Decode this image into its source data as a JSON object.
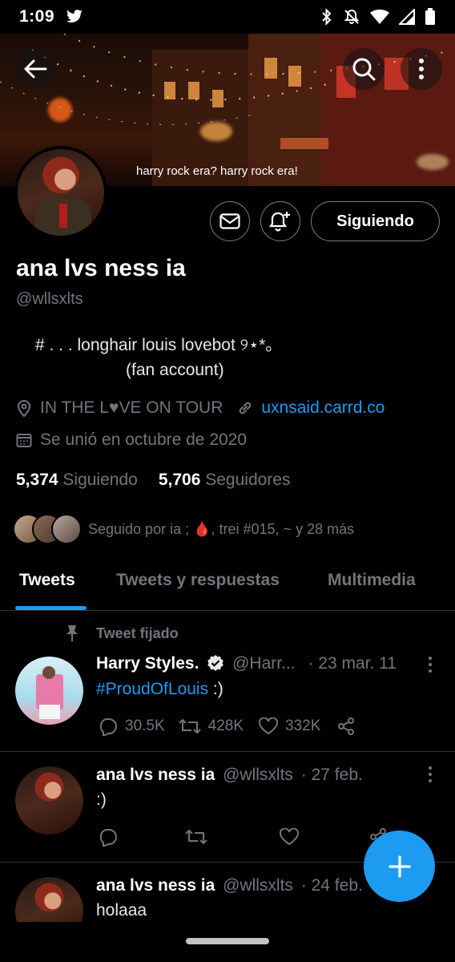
{
  "status_bar": {
    "time": "1:09"
  },
  "banner": {
    "caption": "harry rock era? harry rock era!"
  },
  "profile": {
    "display_name": "ana lvs ness ia",
    "handle": "@wllsxlts",
    "bio_line1": "# . . . longhair louis lovebot ୨⋆*｡",
    "bio_line2": "(fan account)",
    "location": "IN THE L♥VE ON TOUR",
    "website": "uxnsaid.carrd.co",
    "joined": "Se unió en octubre de 2020",
    "following_count": "5,374",
    "following_label": "Siguiendo",
    "followers_count": "5,706",
    "followers_label": "Seguidores",
    "followed_by": "Seguido por ia ; 🩸, trei #015, ~ y 28 más",
    "follow_button": "Siguiendo"
  },
  "tabs": [
    "Tweets",
    "Tweets y respuestas",
    "Multimedia"
  ],
  "pinned_label": "Tweet fijado",
  "tweets": [
    {
      "name": "Harry Styles.",
      "handle": "@Harr...",
      "date": "· 23 mar. 11",
      "text": "#ProudOfLouis",
      "text_suffix": " :)",
      "replies": "30.5K",
      "retweets": "428K",
      "likes": "332K"
    },
    {
      "name": "ana lvs ness ia",
      "handle": "@wllsxlts",
      "date": "· 27 feb.",
      "text": ":)"
    },
    {
      "name": "ana lvs ness ia",
      "handle": "@wllsxlts",
      "date": "· 24 feb.",
      "text": "holaaa"
    }
  ],
  "colors": {
    "accent": "#1d9bf0",
    "background": "#000000",
    "muted": "#71767b"
  }
}
